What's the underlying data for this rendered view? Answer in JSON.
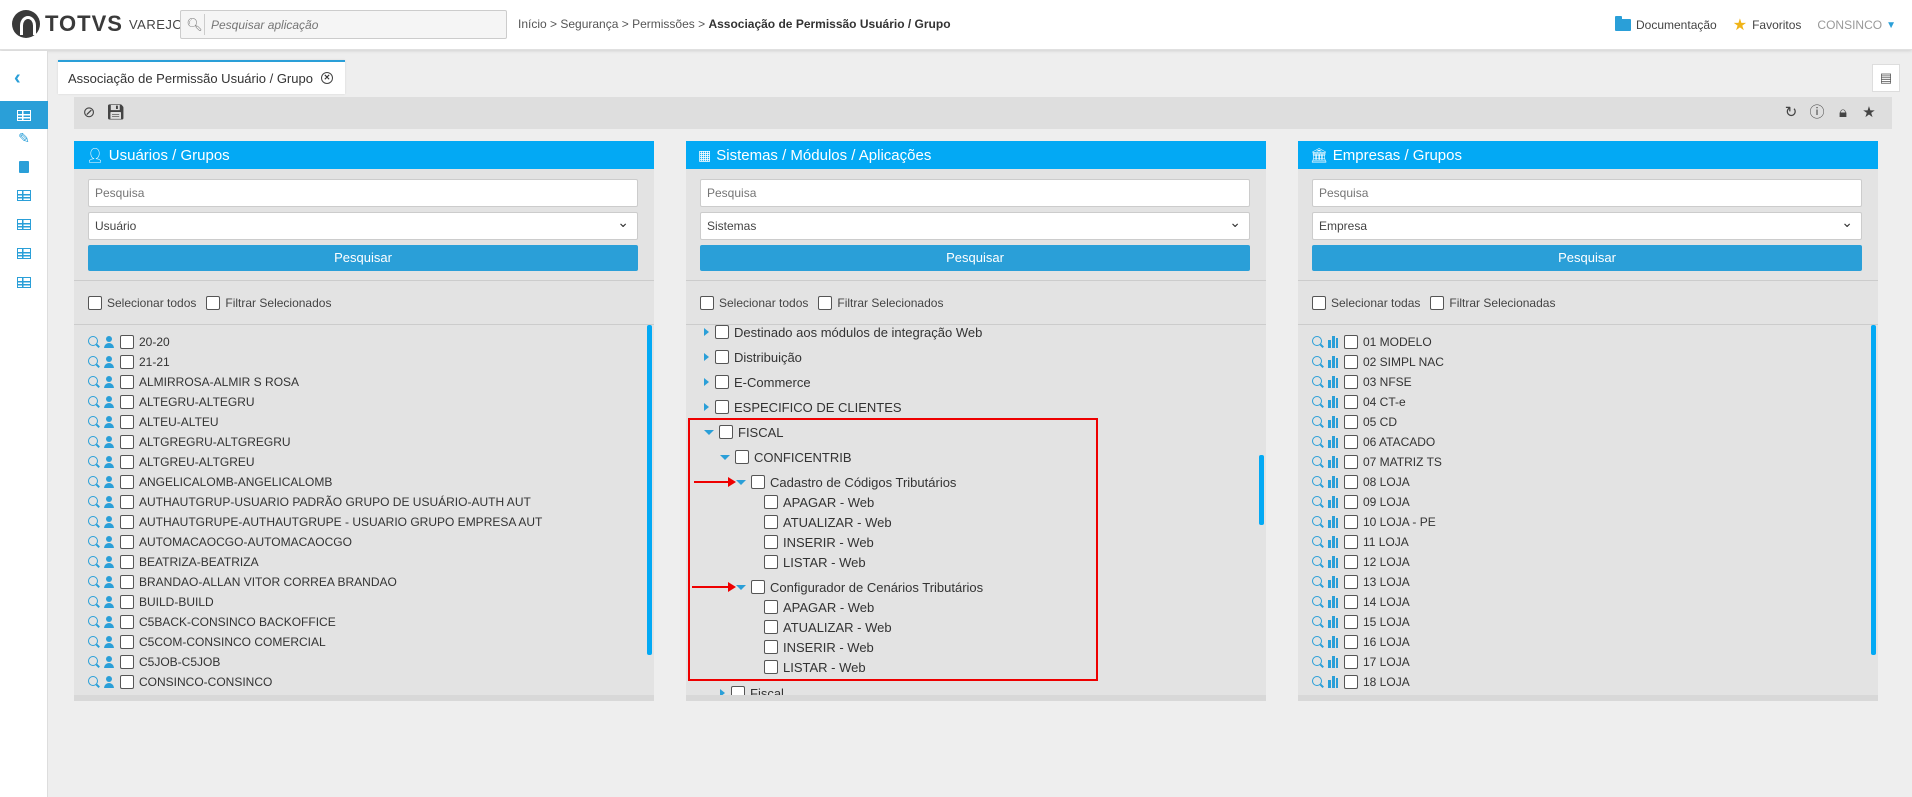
{
  "app": {
    "brand": "TOTVS",
    "sub": "VAREJO"
  },
  "search": {
    "placeholder": "Pesquisar aplicação"
  },
  "breadcrumb": {
    "path": "Início > Segurança > Permissões > ",
    "current": "Associação de Permissão Usuário / Grupo"
  },
  "top_right": {
    "documentation": "Documentação",
    "favorites": "Favoritos",
    "user": "CONSINCO"
  },
  "tab": {
    "title": "Associação de Permissão Usuário / Grupo"
  },
  "panels": {
    "users": {
      "title": "Usuários / Grupos",
      "search_placeholder": "Pesquisa",
      "type_select": "Usuário",
      "search_button": "Pesquisar",
      "select_all": "Selecionar todos",
      "filter_selected": "Filtrar Selecionados",
      "items": [
        "20-20",
        "21-21",
        "ALMIRROSA-ALMIR S ROSA",
        "ALTEGRU-ALTEGRU",
        "ALTEU-ALTEU",
        "ALTGREGRU-ALTGREGRU",
        "ALTGREU-ALTGREU",
        "ANGELICALOMB-ANGELICALOMB",
        "AUTHAUTGRUP-USUARIO PADRÃO GRUPO DE USUÁRIO-AUTH AUT",
        "AUTHAUTGRUPE-AUTHAUTGRUPE - USUARIO GRUPO EMPRESA AUT",
        "AUTOMACAOCGO-AUTOMACAOCGO",
        "BEATRIZA-BEATRIZA",
        "BRANDAO-ALLAN VITOR CORREA BRANDAO",
        "BUILD-BUILD",
        "C5BACK-CONSINCO BACKOFFICE",
        "C5COM-CONSINCO COMERCIAL",
        "C5JOB-C5JOB",
        "CONSINCO-CONSINCO"
      ]
    },
    "systems": {
      "title": "Sistemas / Módulos / Aplicações",
      "search_placeholder": "Pesquisa",
      "type_select": "Sistemas",
      "search_button": "Pesquisar",
      "select_all": "Selecionar todos",
      "filter_selected": "Filtrar Selecionados",
      "tree": {
        "top_items": [
          "Destinado aos módulos de integração Web",
          "Distribuição",
          "E-Commerce",
          "ESPECIFICO DE CLIENTES"
        ],
        "fiscal": "FISCAL",
        "conficentrib": "CONFICENTRIB",
        "app1": "Cadastro de Códigos Tributários",
        "app1_perms": [
          "APAGAR - Web",
          "ATUALIZAR - Web",
          "INSERIR - Web",
          "LISTAR - Web"
        ],
        "app2": "Configurador de Cenários Tributários",
        "app2_perms": [
          "APAGAR - Web",
          "ATUALIZAR - Web",
          "INSERIR - Web",
          "LISTAR - Web"
        ],
        "next_item": "Fiscal"
      }
    },
    "companies": {
      "title": "Empresas / Grupos",
      "search_placeholder": "Pesquisa",
      "type_select": "Empresa",
      "search_button": "Pesquisar",
      "select_all": "Selecionar todas",
      "filter_selected": "Filtrar Selecionadas",
      "items": [
        "01 MODELO",
        "02 SIMPL NAC",
        "03 NFSE",
        "04 CT-e",
        "05 CD",
        "06 ATACADO",
        "07 MATRIZ TS",
        "08 LOJA",
        "09 LOJA",
        "10 LOJA - PE",
        "11 LOJA",
        "12 LOJA",
        "13 LOJA",
        "14 LOJA",
        "15 LOJA",
        "16 LOJA",
        "17 LOJA",
        "18 LOJA"
      ]
    }
  },
  "colors": {
    "accent": "#03a9f4",
    "highlight": "#e00000"
  }
}
